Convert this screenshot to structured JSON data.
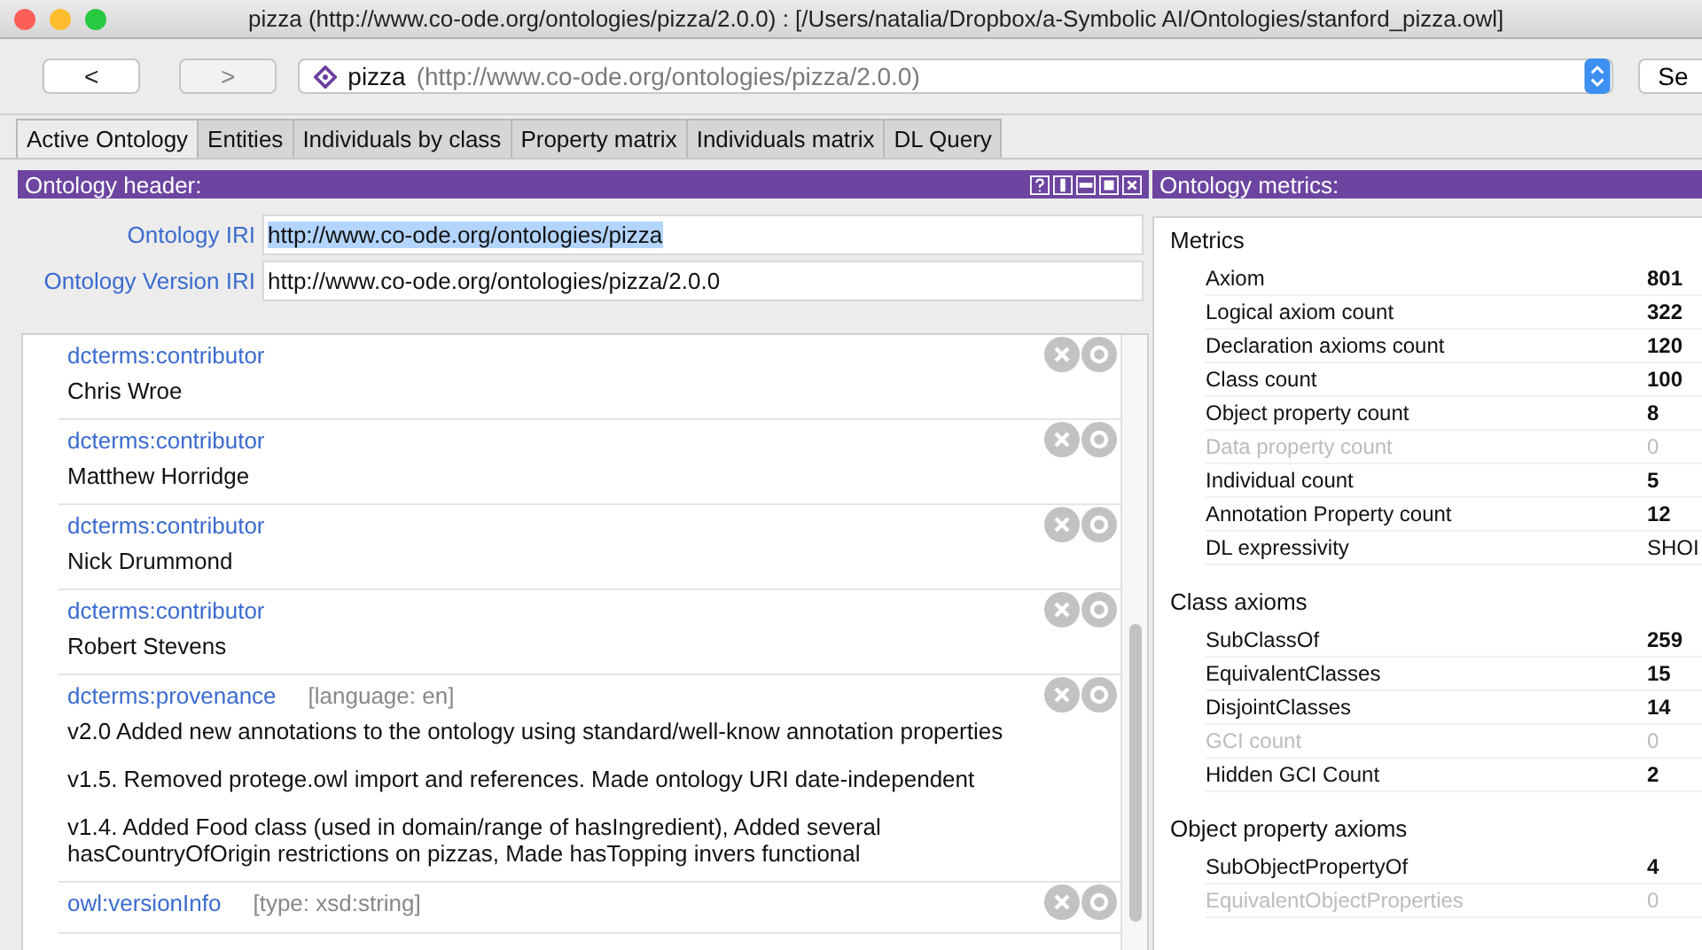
{
  "window": {
    "title": "pizza (http://www.co-ode.org/ontologies/pizza/2.0.0)  : [/Users/natalia/Dropbox/a-Symbolic AI/Ontologies/stanford_pizza.owl]"
  },
  "toolbar": {
    "back": "<",
    "forward": ">",
    "address": {
      "name": "pizza",
      "iri": "(http://www.co-ode.org/ontologies/pizza/2.0.0)"
    },
    "search_button": "Se"
  },
  "tabs": [
    {
      "label": "Active Ontology",
      "selected": true
    },
    {
      "label": "Entities",
      "selected": false
    },
    {
      "label": "Individuals by class",
      "selected": false
    },
    {
      "label": "Property matrix",
      "selected": false
    },
    {
      "label": "Individuals matrix",
      "selected": false
    },
    {
      "label": "DL Query",
      "selected": false
    }
  ],
  "header_panel": {
    "title": "Ontology header:",
    "fields": [
      {
        "label": "Ontology IRI",
        "value": "http://www.co-ode.org/ontologies/pizza",
        "highlighted": true
      },
      {
        "label": "Ontology Version IRI",
        "value": "http://www.co-ode.org/ontologies/pizza/2.0.0",
        "highlighted": false
      }
    ],
    "annotations": [
      {
        "property": "dcterms:contributor",
        "paragraphs": [
          "Chris Wroe"
        ]
      },
      {
        "property": "dcterms:contributor",
        "paragraphs": [
          "Matthew Horridge"
        ]
      },
      {
        "property": "dcterms:contributor",
        "paragraphs": [
          "Nick Drummond"
        ]
      },
      {
        "property": "dcterms:contributor",
        "paragraphs": [
          "Robert Stevens"
        ]
      },
      {
        "property": "dcterms:provenance",
        "qualifier": "[language: en]",
        "paragraphs": [
          "v2.0 Added new annotations to the ontology using standard/well-know annotation properties",
          "v1.5. Removed protege.owl import and references. Made ontology URI date-independent",
          "v1.4. Added Food class (used in domain/range of hasIngredient), Added several hasCountryOfOrigin restrictions on pizzas, Made hasTopping invers functional"
        ]
      },
      {
        "property": "owl:versionInfo",
        "qualifier": "[type: xsd:string]"
      }
    ]
  },
  "metrics_panel": {
    "title": "Ontology metrics:",
    "sections": [
      {
        "title": "Metrics",
        "rows": [
          {
            "label": "Axiom",
            "value": "801",
            "disabled": false
          },
          {
            "label": "Logical axiom count",
            "value": "322",
            "disabled": false
          },
          {
            "label": "Declaration axioms count",
            "value": "120",
            "disabled": false
          },
          {
            "label": "Class count",
            "value": "100",
            "disabled": false
          },
          {
            "label": "Object property count",
            "value": "8",
            "disabled": false
          },
          {
            "label": "Data property count",
            "value": "0",
            "disabled": true
          },
          {
            "label": "Individual count",
            "value": "5",
            "disabled": false
          },
          {
            "label": "Annotation Property count",
            "value": "12",
            "disabled": false
          },
          {
            "label": "DL expressivity",
            "value": "SHOI",
            "disabled": false,
            "kind": "text"
          }
        ]
      },
      {
        "title": "Class axioms",
        "rows": [
          {
            "label": "SubClassOf",
            "value": "259",
            "disabled": false
          },
          {
            "label": "EquivalentClasses",
            "value": "15",
            "disabled": false
          },
          {
            "label": "DisjointClasses",
            "value": "14",
            "disabled": false
          },
          {
            "label": "GCI count",
            "value": "0",
            "disabled": true
          },
          {
            "label": "Hidden GCI Count",
            "value": "2",
            "disabled": false
          }
        ]
      },
      {
        "title": "Object property axioms",
        "rows": [
          {
            "label": "SubObjectPropertyOf",
            "value": "4",
            "disabled": false
          },
          {
            "label": "EquivalentObjectProperties",
            "value": "0",
            "disabled": true
          }
        ]
      }
    ]
  }
}
